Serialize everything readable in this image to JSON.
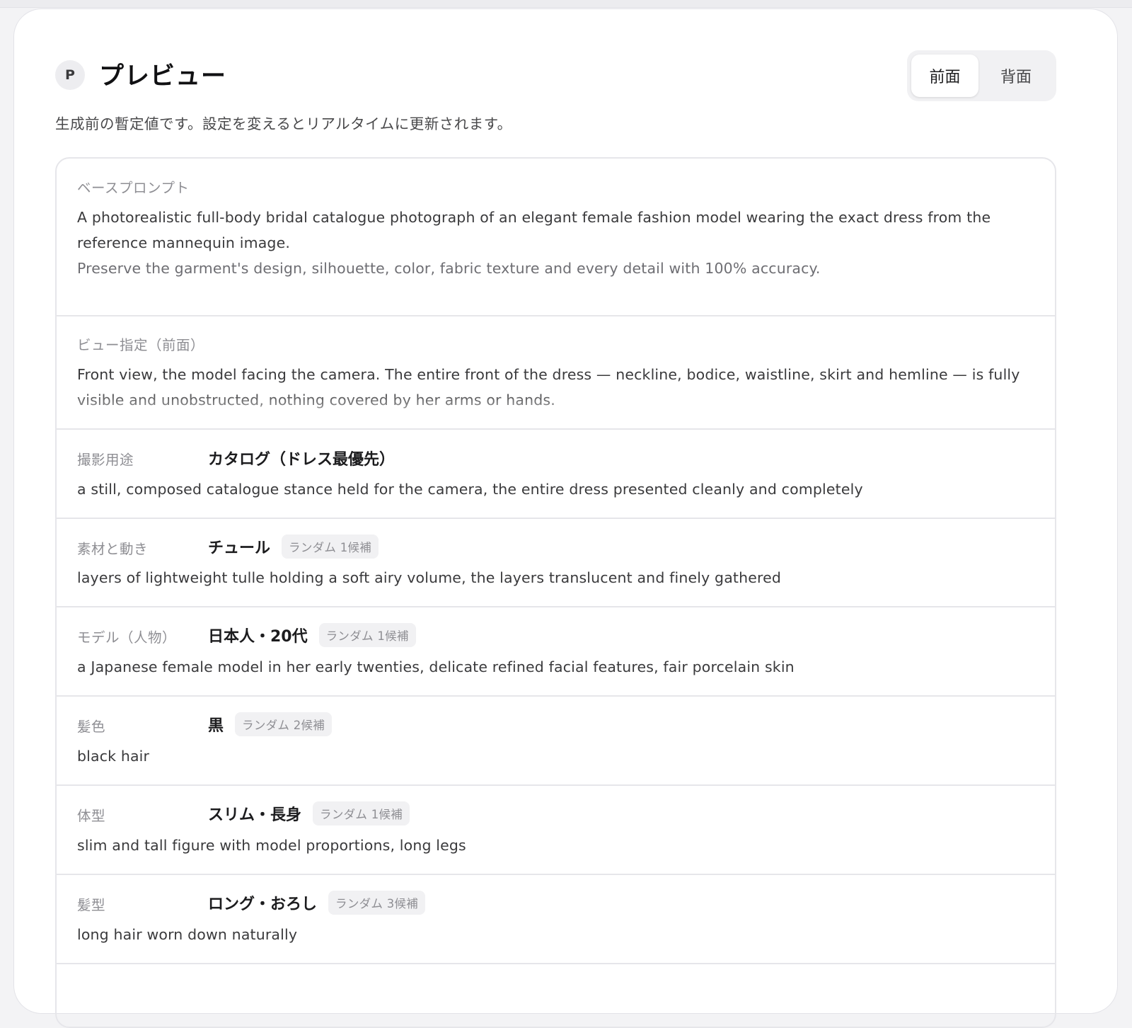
{
  "header": {
    "avatar_letter": "P",
    "title": "プレビュー",
    "subtitle": "生成前の暫定値です。設定を変えるとリアルタイムに更新されます。",
    "view_toggle": {
      "options": [
        "前面",
        "背面"
      ],
      "selected": "前面"
    }
  },
  "base_prompt": {
    "label": "ベースプロンプト",
    "line1": "A photorealistic full-body bridal catalogue photograph of an elegant female fashion model wearing the exact dress from the reference mannequin image.",
    "line2": "Preserve the garment's design, silhouette, color, fabric texture and every detail with 100% accuracy."
  },
  "view_spec": {
    "label": "ビュー指定（前面）",
    "text": "Front view, the model facing the camera. The entire front of the dress — neckline, bodice, waistline, skirt and hemline — is fully visible and unobstructed, nothing covered by her arms or hands."
  },
  "rows": [
    {
      "label": "撮影用途",
      "value": "カタログ（ドレス最優先）",
      "badge": "",
      "desc": "a still, composed catalogue stance held for the camera, the entire dress presented cleanly and completely"
    },
    {
      "label": "素材と動き",
      "value": "チュール",
      "badge": "ランダム 1候補",
      "desc": "layers of lightweight tulle holding a soft airy volume, the layers translucent and finely gathered"
    },
    {
      "label": "モデル（人物）",
      "value": "日本人・20代",
      "badge": "ランダム 1候補",
      "desc": "a Japanese female model in her early twenties, delicate refined facial features, fair porcelain skin"
    },
    {
      "label": "髪色",
      "value": "黒",
      "badge": "ランダム 2候補",
      "desc": "black hair"
    },
    {
      "label": "体型",
      "value": "スリム・長身",
      "badge": "ランダム 1候補",
      "desc": "slim and tall figure with model proportions, long legs"
    },
    {
      "label": "髪型",
      "value": "ロング・おろし",
      "badge": "ランダム 3候補",
      "desc": "long hair worn down naturally"
    }
  ]
}
